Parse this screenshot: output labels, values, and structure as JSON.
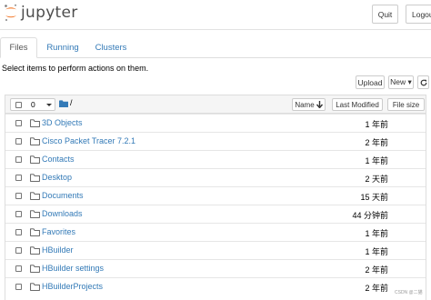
{
  "header": {
    "logo_text": "jupyter",
    "quit_label": "Quit",
    "logout_label": "Logout"
  },
  "tabs": [
    {
      "label": "Files",
      "active": true
    },
    {
      "label": "Running",
      "active": false
    },
    {
      "label": "Clusters",
      "active": false
    }
  ],
  "hint": "Select items to perform actions on them.",
  "toolbar": {
    "upload_label": "Upload",
    "new_label": "New ▾"
  },
  "list_header": {
    "selected_count": "0",
    "breadcrumb": "/",
    "name_label": "Name",
    "last_modified_label": "Last Modified",
    "file_size_label": "File size"
  },
  "rows": [
    {
      "name": "3D Objects",
      "modified": "1 年前"
    },
    {
      "name": "Cisco Packet Tracer 7.2.1",
      "modified": "2 年前"
    },
    {
      "name": "Contacts",
      "modified": "1 年前"
    },
    {
      "name": "Desktop",
      "modified": "2 天前"
    },
    {
      "name": "Documents",
      "modified": "15 天前"
    },
    {
      "name": "Downloads",
      "modified": "44 分钟前"
    },
    {
      "name": "Favorites",
      "modified": "1 年前"
    },
    {
      "name": "HBuilder",
      "modified": "1 年前"
    },
    {
      "name": "HBuilder settings",
      "modified": "2 年前"
    },
    {
      "name": "HBuilderProjects",
      "modified": "2 年前"
    }
  ],
  "watermark": "CSDN @二猫",
  "colors": {
    "link": "#337ab7",
    "logo_orange": "#f37626",
    "header_bg": "#f5f5f5"
  }
}
